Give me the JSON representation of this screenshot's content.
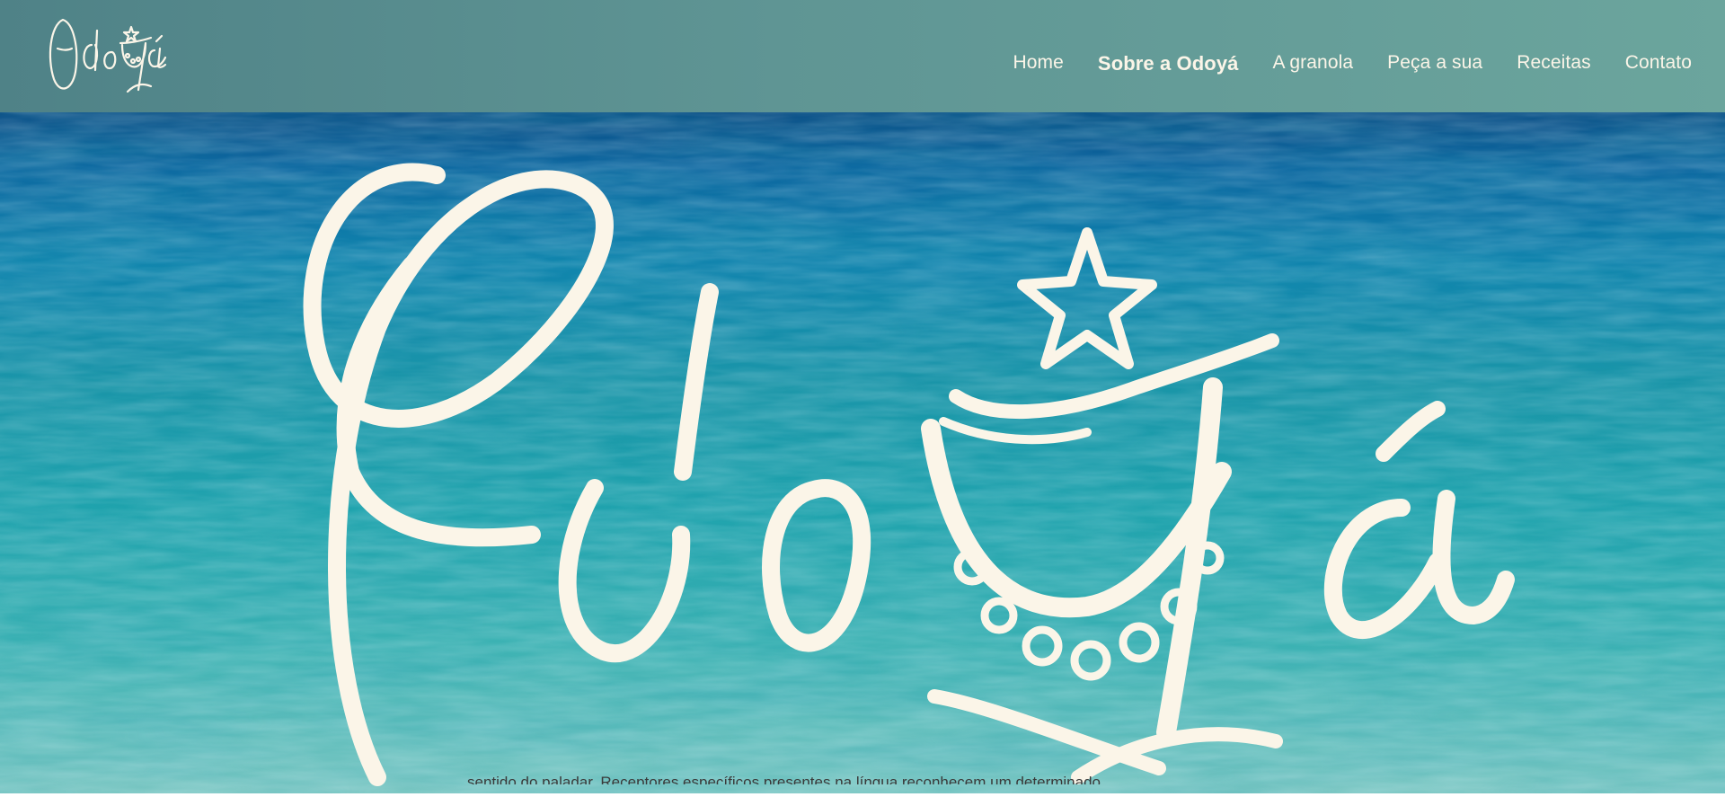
{
  "brand": {
    "name": "Odoyá"
  },
  "nav": {
    "items": [
      {
        "label": "Home",
        "active": false
      },
      {
        "label": "Sobre a Odoyá",
        "active": true
      },
      {
        "label": "A granola",
        "active": false
      },
      {
        "label": "Peça a sua",
        "active": false
      },
      {
        "label": "Receitas",
        "active": false
      },
      {
        "label": "Contato",
        "active": false
      }
    ]
  },
  "hero": {
    "background": "ocean-water-photo",
    "logo_icon": "odoya-script-logo-icon"
  },
  "content": {
    "partial_text": "sentido do paladar. Receptores específicos presentes na língua reconhecem um determinado"
  },
  "colors": {
    "header_start": "#4f8287",
    "header_end": "#6ba59d",
    "logo_cream": "#fbf5e8",
    "water_deep": "#0a5a8a",
    "water_turquoise": "#1fa3ad"
  }
}
